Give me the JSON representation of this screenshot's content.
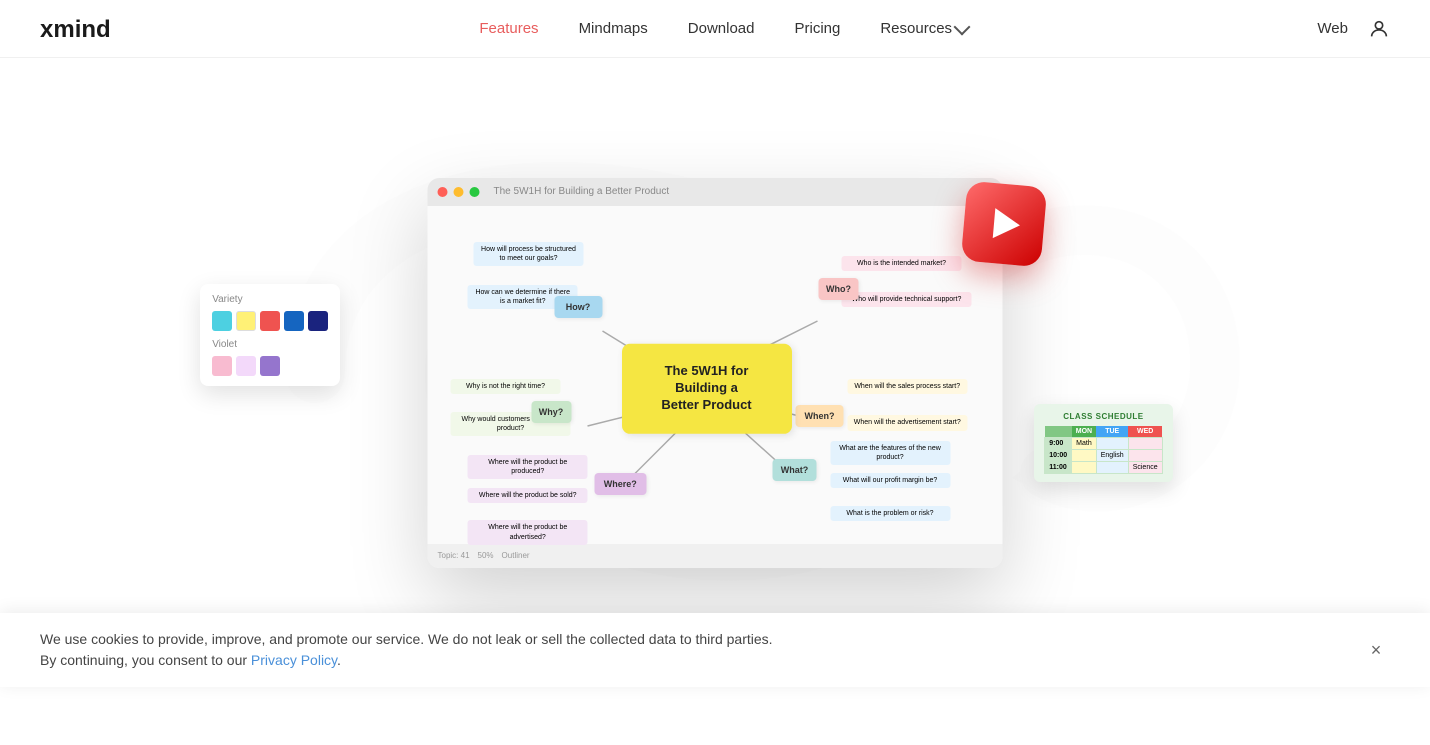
{
  "nav": {
    "logo": "xmind",
    "links": [
      {
        "id": "features",
        "label": "Features",
        "active": true
      },
      {
        "id": "mindmaps",
        "label": "Mindmaps",
        "active": false
      },
      {
        "id": "download",
        "label": "Download",
        "active": false
      },
      {
        "id": "pricing",
        "label": "Pricing",
        "active": false
      }
    ],
    "resources": "Resources",
    "web": "Web"
  },
  "hero": {
    "screenshot_title": "The 5W1H for Building a Better Product",
    "mindmap_center": "The 5W1H for\nBuilding a\nBetter Product",
    "branches": [
      {
        "id": "how",
        "label": "How?"
      },
      {
        "id": "who",
        "label": "Who?"
      },
      {
        "id": "why",
        "label": "Why?"
      },
      {
        "id": "when",
        "label": "When?"
      },
      {
        "id": "where",
        "label": "Where?"
      },
      {
        "id": "what",
        "label": "What?"
      }
    ]
  },
  "palette": {
    "variety_label": "Variety",
    "violet_label": "Violet",
    "swatches": [
      "#4dd0e1",
      "#fff176",
      "#ef5350",
      "#1565c0",
      "#1a237e"
    ],
    "violet_swatches": [
      "#f8bbd0",
      "#ce93d8",
      "#9575cd"
    ]
  },
  "schedule": {
    "title": "CLASS SCHEDULE",
    "headers": [
      "",
      "MON",
      "TUE",
      "WED"
    ],
    "rows": [
      [
        "9:00",
        "Math",
        "",
        ""
      ],
      [
        "10:00",
        "",
        "English",
        ""
      ],
      [
        "11:00",
        "",
        "",
        "Science"
      ]
    ]
  },
  "cookie": {
    "text": "We use cookies to provide, improve, and promote our service. We do not leak or sell the collected data to third parties.\nBy continuing, you consent to our ",
    "link_text": "Privacy Policy",
    "link_suffix": ".",
    "close_label": "×"
  }
}
